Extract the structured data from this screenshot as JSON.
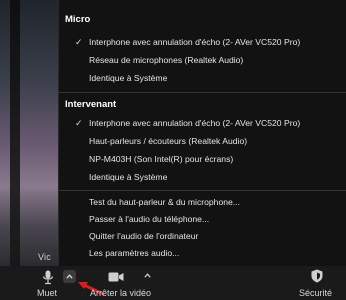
{
  "video_tile": {
    "name_label": "Vic"
  },
  "menu": {
    "micro": {
      "title": "Micro",
      "items": [
        {
          "label": "Interphone avec annulation d'écho (2- AVer VC520 Pro)",
          "checked": true
        },
        {
          "label": "Réseau de microphones (Realtek Audio)",
          "checked": false
        },
        {
          "label": "Identique à Système",
          "checked": false
        }
      ]
    },
    "intervenant": {
      "title": "Intervenant",
      "items": [
        {
          "label": "Interphone avec annulation d'écho (2- AVer VC520 Pro)",
          "checked": true
        },
        {
          "label": "Haut-parleurs / écouteurs (Realtek Audio)",
          "checked": false
        },
        {
          "label": "NP-M403H (Son Intel(R) pour écrans)",
          "checked": false
        },
        {
          "label": "Identique à Système",
          "checked": false
        }
      ]
    },
    "actions": [
      {
        "label": "Test du haut-parleur & du microphone..."
      },
      {
        "label": "Passer à l'audio du téléphone..."
      },
      {
        "label": "Quitter l'audio de l'ordinateur"
      },
      {
        "label": "Les paramètres audio..."
      }
    ],
    "check_glyph": "✓"
  },
  "toolbar": {
    "mute_label": "Muet",
    "video_label": "Arrêter la vidéo",
    "security_label": "Sécurité",
    "caret_glyph": "^"
  },
  "icons": {
    "mic": "microphone-icon",
    "video": "video-camera-icon",
    "security": "shield-icon",
    "caret": "chevron-up-icon"
  },
  "colors": {
    "menu_bg": "#121212",
    "toolbar_bg": "#1a1a1a",
    "annotation_arrow": "#d62020"
  }
}
